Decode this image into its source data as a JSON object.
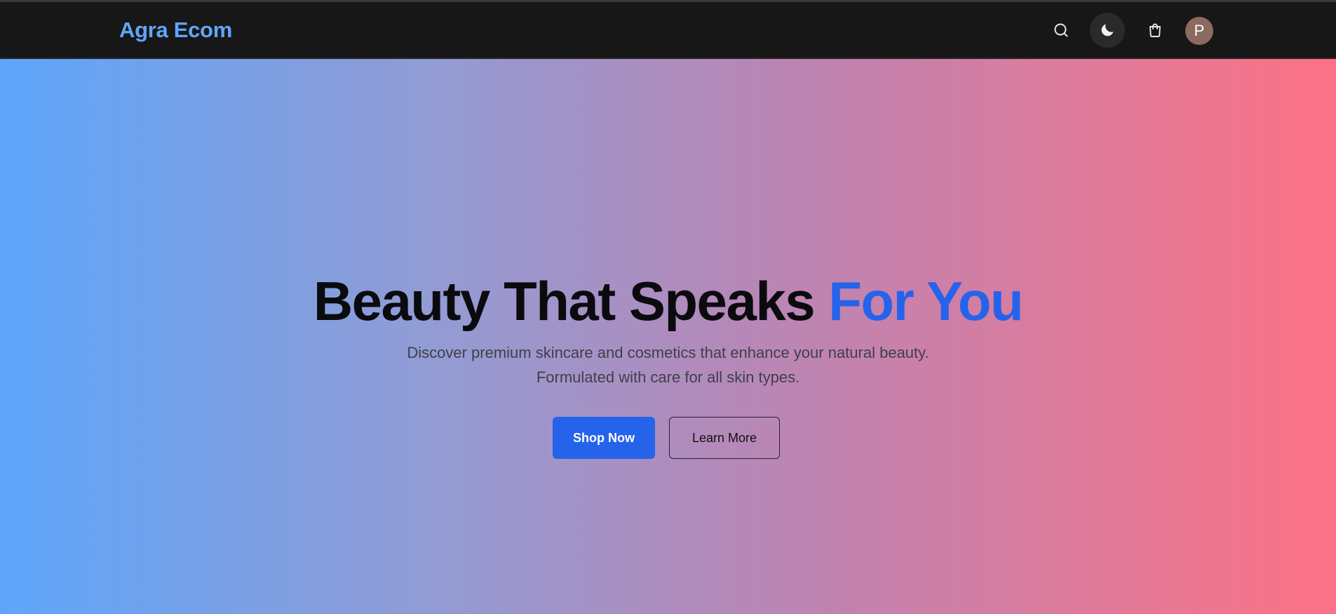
{
  "header": {
    "brand": "Agra Ecom",
    "icons": {
      "search": "search-icon",
      "theme": "moon-icon",
      "cart": "shopping-bag-icon"
    },
    "avatar_initial": "P"
  },
  "hero": {
    "title_main": "Beauty That Speaks ",
    "title_accent": "For You",
    "subtitle_line1": "Discover premium skincare and cosmetics that enhance your natural beauty.",
    "subtitle_line2": "Formulated with care for all skin types.",
    "primary_button": "Shop Now",
    "secondary_button": "Learn More"
  },
  "colors": {
    "brand": "#60a5fa",
    "accent": "#2563eb",
    "navbar_bg": "#171717",
    "gradient_start": "#5ea6fb",
    "gradient_end": "#fd7286",
    "avatar_bg": "#8c6a5f"
  }
}
